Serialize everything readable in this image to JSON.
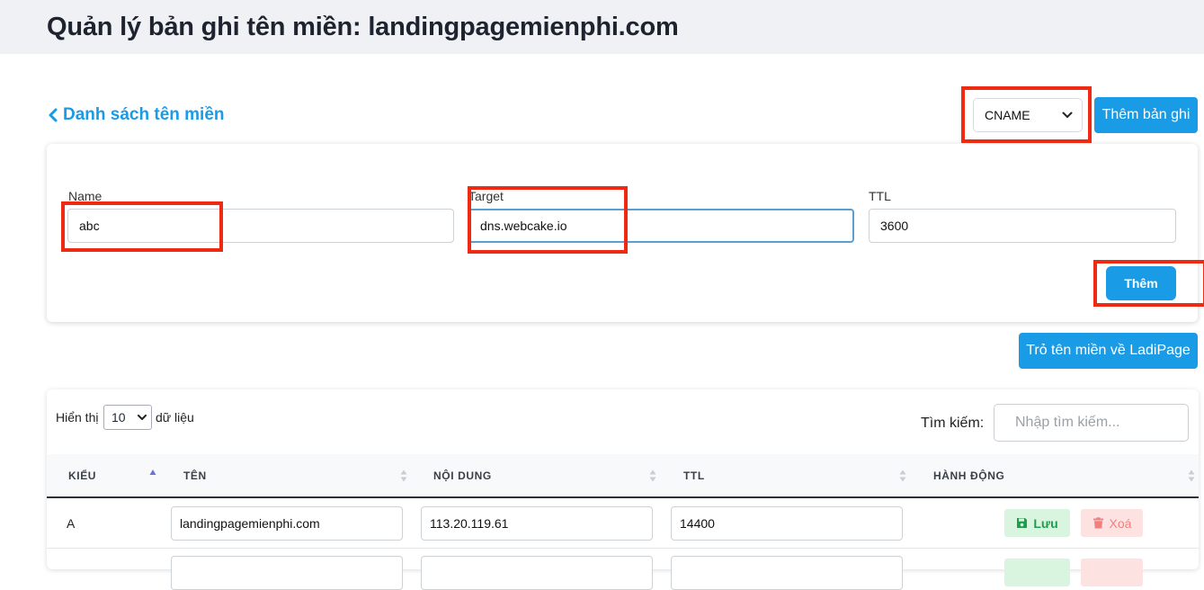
{
  "page": {
    "title": "Quản lý bản ghi tên miền: landingpagemienphi.com"
  },
  "nav": {
    "back_label": "Danh sách tên miền"
  },
  "toolbar": {
    "record_type_selected": "CNAME",
    "add_record_label": "Thêm bản ghi"
  },
  "form": {
    "name_label": "Name",
    "name_value": "abc",
    "target_label": "Target",
    "target_value": "dns.webcake.io",
    "ttl_label": "TTL",
    "ttl_value": "3600",
    "submit_label": "Thêm"
  },
  "point_button_label": "Trỏ tên miền về LadiPage",
  "table": {
    "show_label": "Hiển thị",
    "page_size": "10",
    "show_suffix": "dữ liệu",
    "search_label": "Tìm kiếm:",
    "search_placeholder": "Nhập tìm kiếm...",
    "columns": [
      "KIỂU",
      "TÊN",
      "NỘI DUNG",
      "TTL",
      "HÀNH ĐỘNG"
    ],
    "rows": [
      {
        "type": "A",
        "name": "landingpagemienphi.com",
        "content": "113.20.119.61",
        "ttl": "14400"
      }
    ],
    "save_label": "Lưu",
    "delete_label": "Xoá"
  },
  "colors": {
    "primary": "#1a9be6",
    "highlight": "#ef2a12",
    "save_bg": "#d9f5df",
    "delete_bg": "#fde2e2"
  }
}
